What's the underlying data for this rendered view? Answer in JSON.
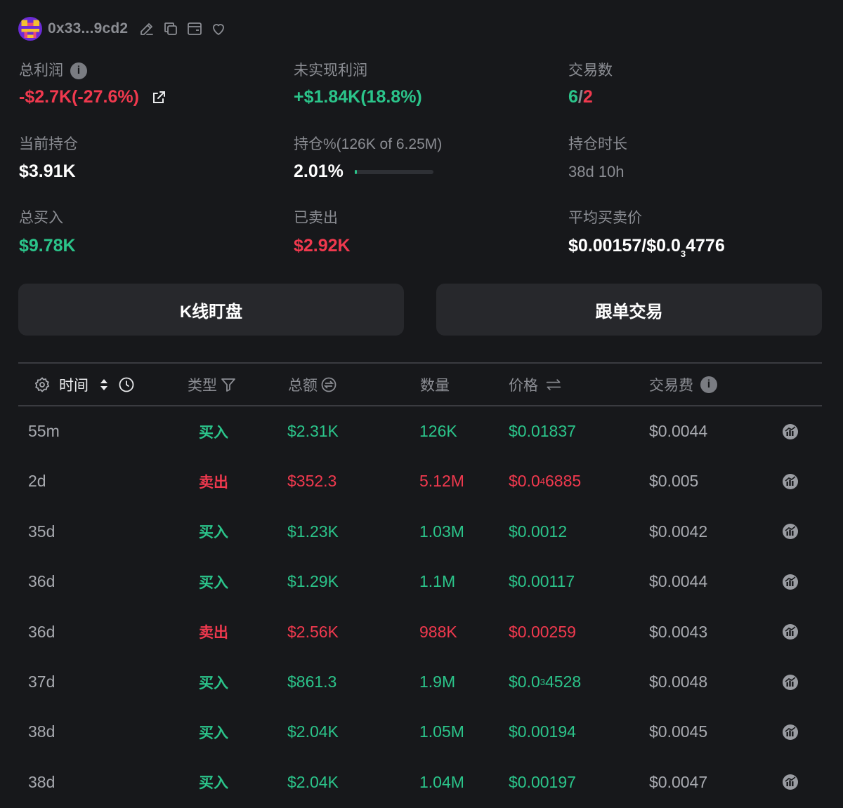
{
  "header": {
    "address": "0x33...9cd2",
    "icons": [
      "edit-icon",
      "copy-icon",
      "wallet-icon",
      "heart-icon"
    ]
  },
  "stats": {
    "total_profit": {
      "label": "总利润",
      "value": "-$2.7K(-27.6%)"
    },
    "unrealized_profit": {
      "label": "未实现利润",
      "value": "+$1.84K(18.8%)"
    },
    "trade_count": {
      "label": "交易数",
      "buys": "6",
      "sep": "/",
      "sells": "2"
    },
    "current_position": {
      "label": "当前持仓",
      "value": "$3.91K"
    },
    "position_pct": {
      "label": "持仓%(126K of 6.25M)",
      "value": "2.01%",
      "progress": 0.0201
    },
    "holding_time": {
      "label": "持仓时长",
      "value": "38d 10h"
    },
    "total_bought": {
      "label": "总买入",
      "value": "$9.78K"
    },
    "sold": {
      "label": "已卖出",
      "value": "$2.92K"
    },
    "avg_price": {
      "label": "平均买卖价",
      "value_a": "$0.00157/$0.0",
      "sub": "3",
      "value_b": "4776"
    }
  },
  "buttons": {
    "kline": "K线盯盘",
    "copy_trade": "跟单交易"
  },
  "table": {
    "headers": {
      "time": "时间",
      "type": "类型",
      "total": "总额",
      "qty": "数量",
      "price": "价格",
      "fee": "交易费"
    },
    "rows": [
      {
        "time": "55m",
        "type": "买入",
        "side": "buy",
        "total": "$2.31K",
        "qty": "126K",
        "price_a": "$0.01837",
        "price_sub": "",
        "price_b": "",
        "fee": "$0.0044"
      },
      {
        "time": "2d",
        "type": "卖出",
        "side": "sell",
        "total": "$352.3",
        "qty": "5.12M",
        "price_a": "$0.0",
        "price_sub": "4",
        "price_b": "6885",
        "fee": "$0.005"
      },
      {
        "time": "35d",
        "type": "买入",
        "side": "buy",
        "total": "$1.23K",
        "qty": "1.03M",
        "price_a": "$0.0012",
        "price_sub": "",
        "price_b": "",
        "fee": "$0.0042"
      },
      {
        "time": "36d",
        "type": "买入",
        "side": "buy",
        "total": "$1.29K",
        "qty": "1.1M",
        "price_a": "$0.00117",
        "price_sub": "",
        "price_b": "",
        "fee": "$0.0044"
      },
      {
        "time": "36d",
        "type": "卖出",
        "side": "sell",
        "total": "$2.56K",
        "qty": "988K",
        "price_a": "$0.00259",
        "price_sub": "",
        "price_b": "",
        "fee": "$0.0043"
      },
      {
        "time": "37d",
        "type": "买入",
        "side": "buy",
        "total": "$861.3",
        "qty": "1.9M",
        "price_a": "$0.0",
        "price_sub": "3",
        "price_b": "4528",
        "fee": "$0.0048"
      },
      {
        "time": "38d",
        "type": "买入",
        "side": "buy",
        "total": "$2.04K",
        "qty": "1.05M",
        "price_a": "$0.00194",
        "price_sub": "",
        "price_b": "",
        "fee": "$0.0045"
      },
      {
        "time": "38d",
        "type": "买入",
        "side": "buy",
        "total": "$2.04K",
        "qty": "1.04M",
        "price_a": "$0.00197",
        "price_sub": "",
        "price_b": "",
        "fee": "$0.0047"
      }
    ]
  },
  "colors": {
    "green": "#2bc48a",
    "red": "#f0394e",
    "background": "#17181b",
    "button": "#27282c"
  }
}
